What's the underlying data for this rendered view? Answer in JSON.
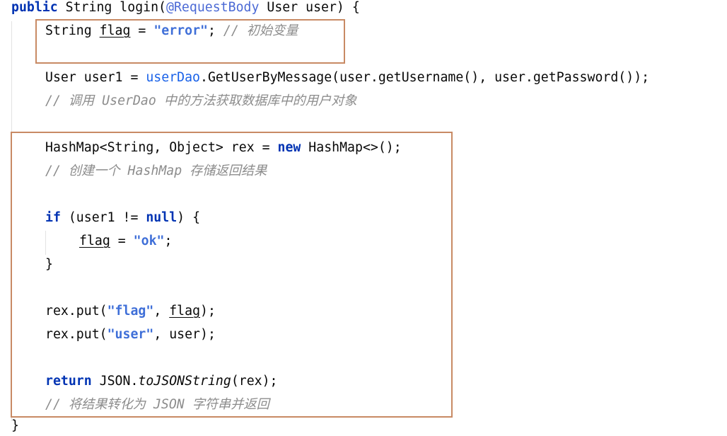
{
  "code": {
    "l1": {
      "kw": "public",
      "t1": " String login(",
      "anno": "@RequestBody",
      "t2": " User user) {"
    },
    "l2": {
      "t1": "String ",
      "var": "flag",
      "t2": " = ",
      "str": "\"error\"",
      "t3": "; ",
      "cmt": "// 初始变量"
    },
    "l3": {
      "t1": "User user1 = ",
      "field": "userDao",
      "t2": ".GetUserByMessage(user.getUsername(), user.getPassword());"
    },
    "l4": {
      "cmt": "// 调用 UserDao 中的方法获取数据库中的用户对象"
    },
    "l5": {
      "t1": "HashMap<String, Object> rex = ",
      "kw": "new",
      "t2": " HashMap<>();"
    },
    "l6": {
      "cmt": "// 创建一个 HashMap 存储返回结果"
    },
    "l7": {
      "kw1": "if",
      "t1": " (user1 != ",
      "kw2": "null",
      "t2": ") {"
    },
    "l8": {
      "var": "flag",
      "t1": " = ",
      "str": "\"ok\"",
      "t2": ";"
    },
    "l9": {
      "t1": "}"
    },
    "l10": {
      "t1": "rex.put(",
      "str": "\"flag\"",
      "t2": ", ",
      "var": "flag",
      "t3": ");"
    },
    "l11": {
      "t1": "rex.put(",
      "str": "\"user\"",
      "t2": ", user);"
    },
    "l12": {
      "kw": "return",
      "t1": " JSON.",
      "method": "toJSONString",
      "t2": "(rex);"
    },
    "l13": {
      "cmt": "// 将结果转化为 JSON 字符串并返回"
    },
    "l14": {
      "t1": "}"
    }
  },
  "colors": {
    "keyword": "#0033b3",
    "string": "#3f6fd8",
    "annotation": "#4c6ad5",
    "field": "#1a62e8",
    "comment": "#8c8c8c",
    "highlight_box": "#c88a64"
  }
}
